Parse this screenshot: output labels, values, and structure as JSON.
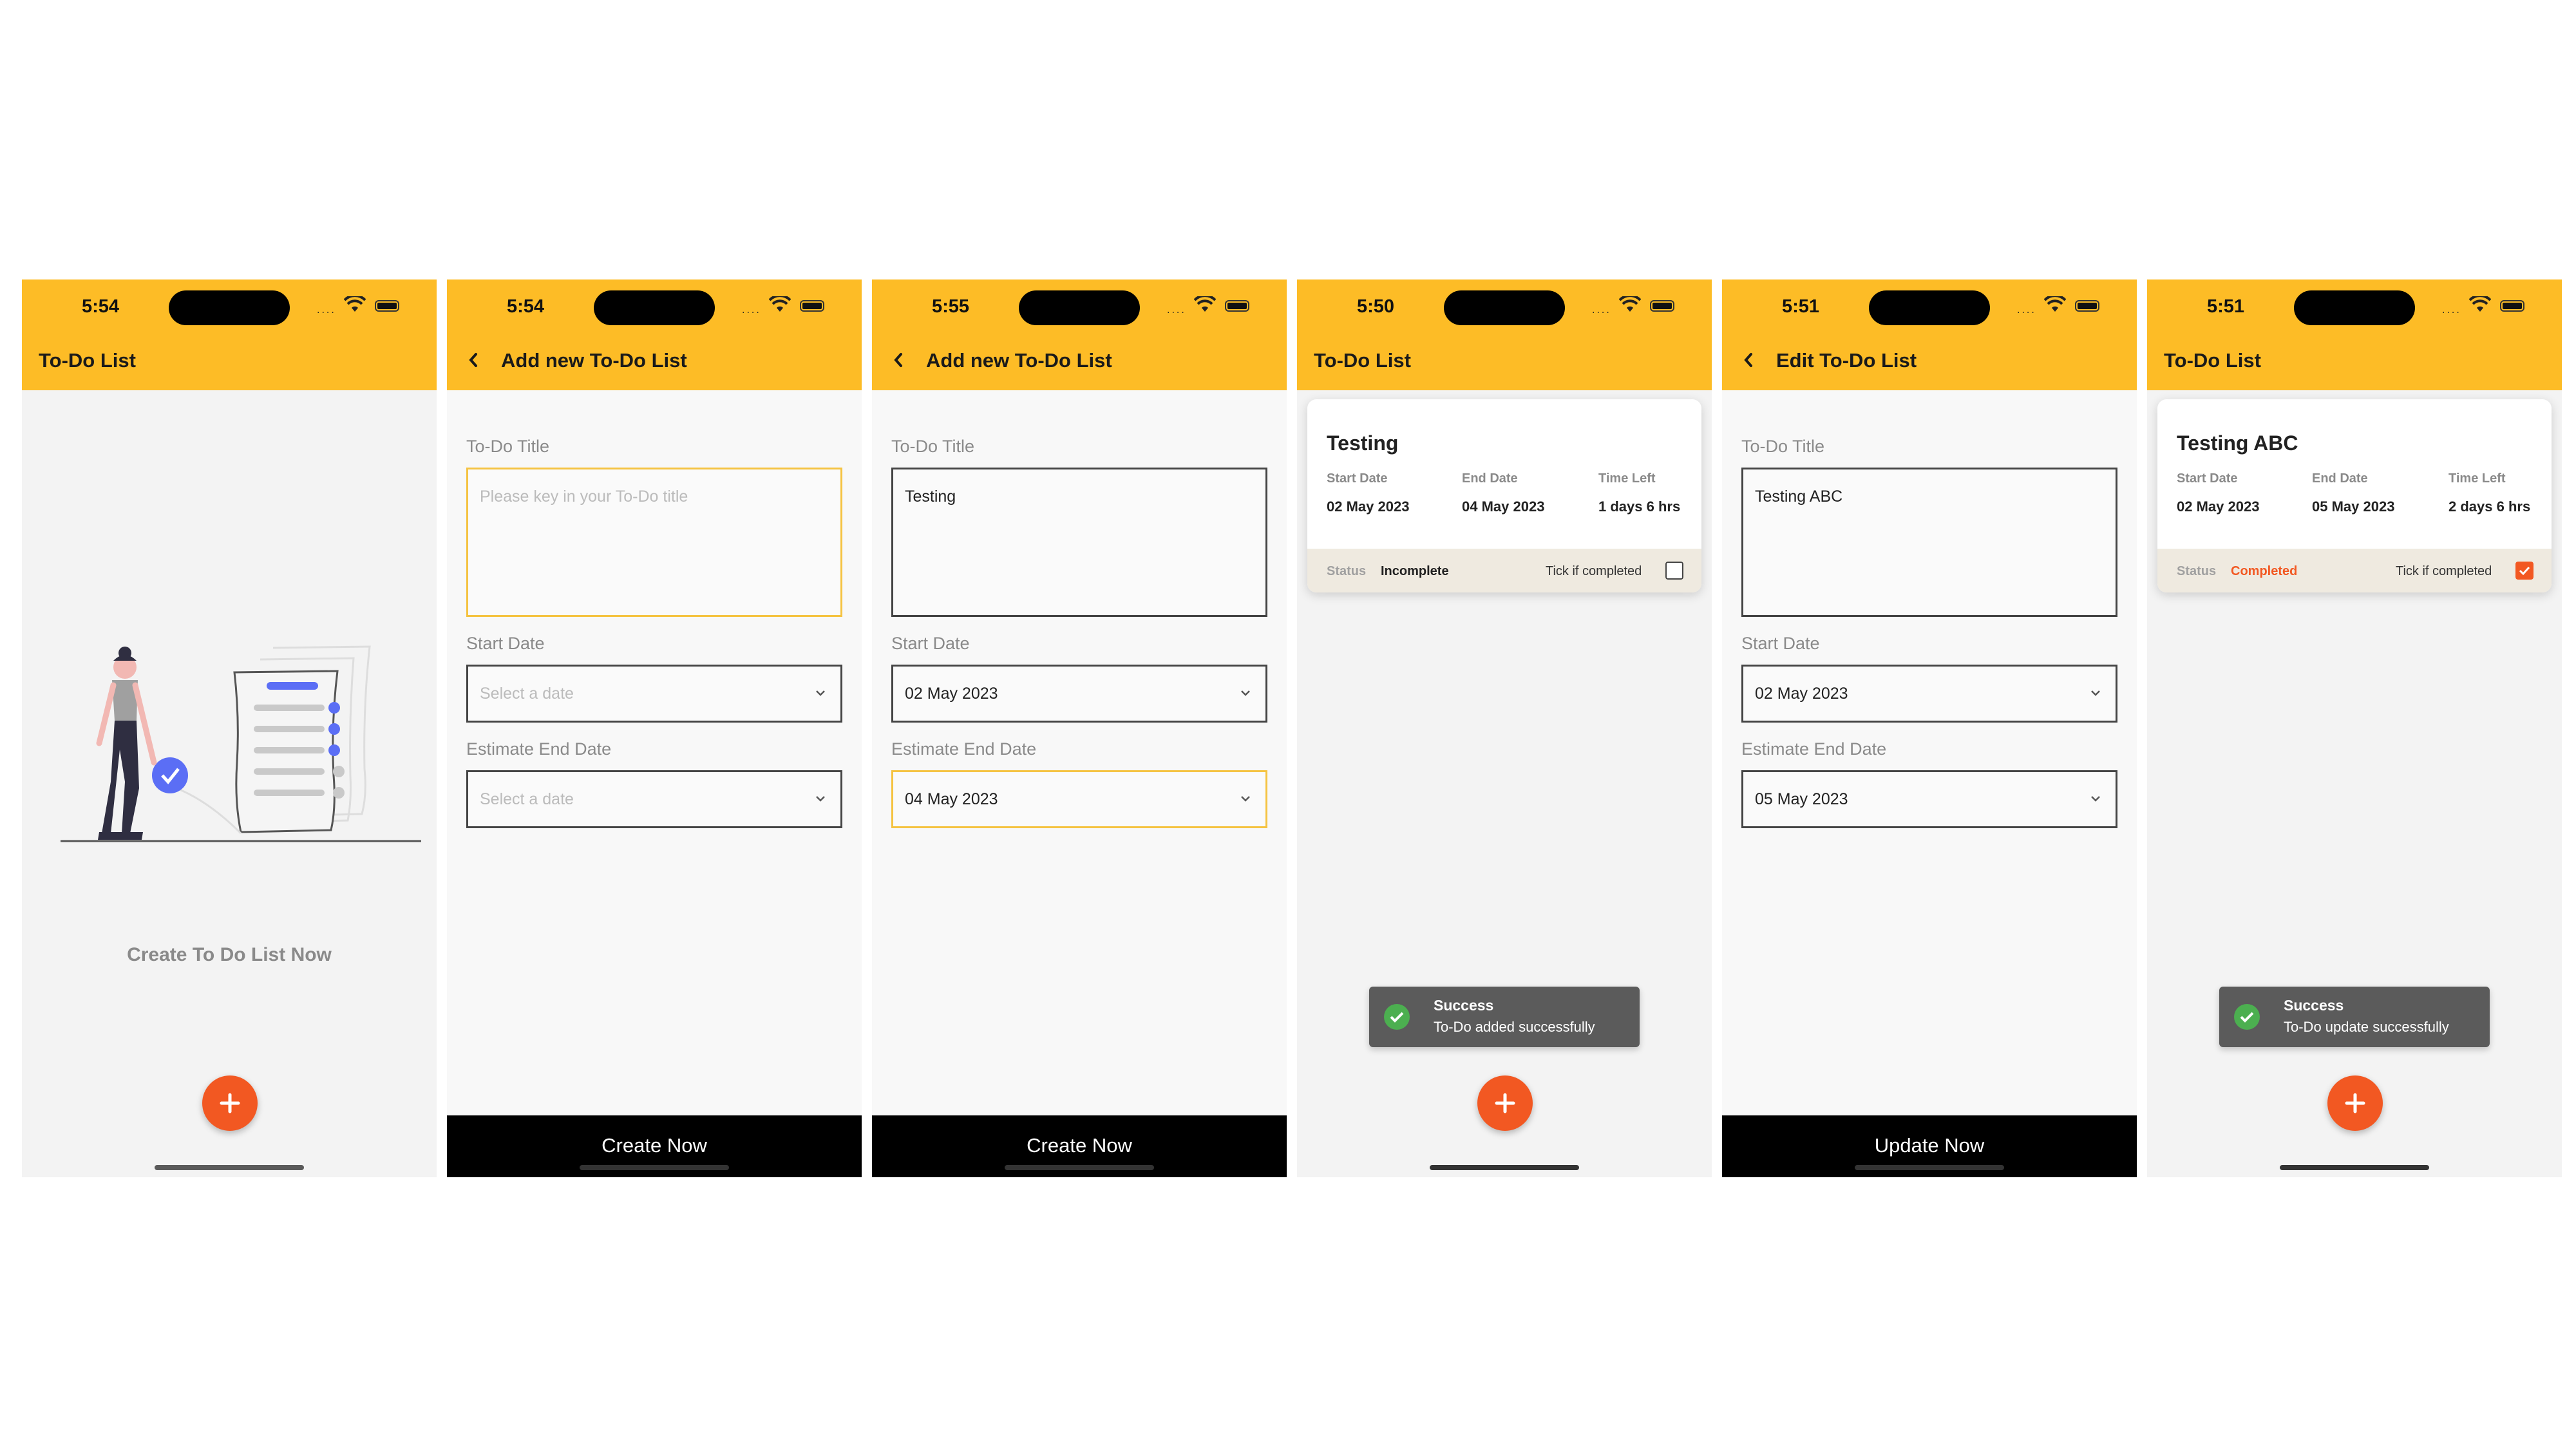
{
  "colors": {
    "header": "#fdbc26",
    "accent": "#f25822",
    "completed": "#f25822",
    "toast_bg": "#5b5b5b",
    "success_icon": "#4caf50"
  },
  "screens": [
    {
      "time": "5:54",
      "title": "To-Do List",
      "empty_text": "Create To Do List Now"
    },
    {
      "time": "5:54",
      "title": "Add new To-Do List",
      "title_label": "To-Do Title",
      "title_placeholder": "Please key in your To-Do title",
      "start_label": "Start Date",
      "start_placeholder": "Select a date",
      "end_label": "Estimate End Date",
      "end_placeholder": "Select a date",
      "button": "Create Now"
    },
    {
      "time": "5:55",
      "title": "Add new To-Do List",
      "title_label": "To-Do Title",
      "title_value": "Testing",
      "start_label": "Start Date",
      "start_value": "02 May 2023",
      "end_label": "Estimate End Date",
      "end_value": "04 May 2023",
      "button": "Create Now"
    },
    {
      "time": "5:50",
      "title": "To-Do List",
      "card": {
        "title": "Testing",
        "start_label": "Start Date",
        "start_value": "02 May 2023",
        "end_label": "End Date",
        "end_value": "04 May 2023",
        "left_label": "Time Left",
        "left_value": "1 days 6 hrs",
        "status_label": "Status",
        "status_value": "Incomplete",
        "tick_label": "Tick if completed",
        "completed": false
      },
      "toast": {
        "title": "Success",
        "message": "To-Do added successfully"
      }
    },
    {
      "time": "5:51",
      "title": "Edit To-Do List",
      "title_label": "To-Do Title",
      "title_value": "Testing ABC",
      "start_label": "Start Date",
      "start_value": "02 May 2023",
      "end_label": "Estimate End Date",
      "end_value": "05 May 2023",
      "button": "Update Now"
    },
    {
      "time": "5:51",
      "title": "To-Do List",
      "card": {
        "title": "Testing ABC",
        "start_label": "Start Date",
        "start_value": "02 May 2023",
        "end_label": "End Date",
        "end_value": "05 May 2023",
        "left_label": "Time Left",
        "left_value": "2 days 6 hrs",
        "status_label": "Status",
        "status_value": "Completed",
        "tick_label": "Tick if completed",
        "completed": true
      },
      "toast": {
        "title": "Success",
        "message": "To-Do update successfully"
      }
    }
  ]
}
